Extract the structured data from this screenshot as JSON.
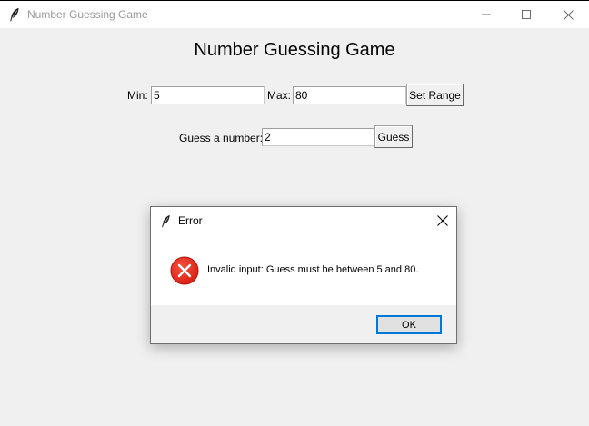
{
  "window": {
    "title": "Number Guessing Game",
    "controls": {
      "minimize_icon": "minimize-icon",
      "maximize_icon": "maximize-icon",
      "close_icon": "close-icon"
    }
  },
  "game": {
    "heading": "Number Guessing Game",
    "range": {
      "min_label": "Min:",
      "min_value": "5",
      "max_label": "Max:",
      "max_value": "80",
      "set_button": "Set Range"
    },
    "guess": {
      "label": "Guess a number:",
      "value": "2",
      "button": "Guess"
    }
  },
  "dialog": {
    "title": "Error",
    "icon": "error-icon",
    "message": "Invalid input: Guess must be between 5 and 80.",
    "ok_button": "OK"
  },
  "colors": {
    "background": "#f0f0f0",
    "dialog_bg": "#ffffff",
    "error_red": "#e81123",
    "focus_blue": "#0078d7"
  }
}
